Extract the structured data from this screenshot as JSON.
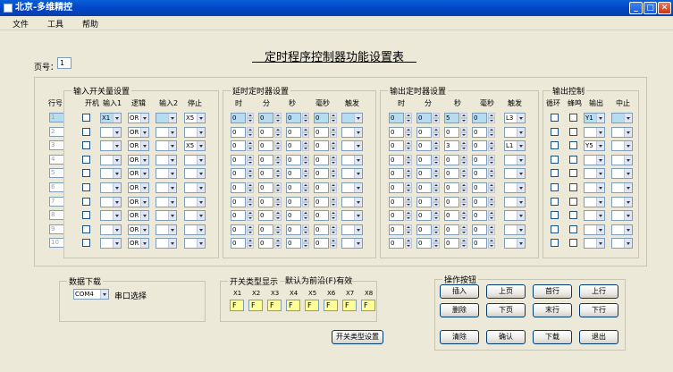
{
  "window": {
    "title": "北京-多维精控",
    "min": "_",
    "max": "□",
    "close": "✕"
  },
  "menu": [
    "文件",
    "工具",
    "帮助"
  ],
  "main_title": "定时程序控制器功能设置表",
  "page": {
    "label": "页号：",
    "value": "1"
  },
  "row_header": "行号",
  "row_numbers": [
    "1",
    "2",
    "3",
    "4",
    "5",
    "6",
    "7",
    "8",
    "9",
    "10"
  ],
  "input_switch": {
    "title": "输入开关量设置",
    "headers": [
      "开机",
      "输入1",
      "逻辑",
      "输入2",
      "停止"
    ],
    "rows": [
      {
        "in1": "X1",
        "logic": "OR",
        "in2": "",
        "stop": "X5"
      },
      {
        "in1": "",
        "logic": "OR",
        "in2": "",
        "stop": ""
      },
      {
        "in1": "",
        "logic": "OR",
        "in2": "",
        "stop": "X5"
      },
      {
        "in1": "",
        "logic": "OR",
        "in2": "",
        "stop": ""
      },
      {
        "in1": "",
        "logic": "OR",
        "in2": "",
        "stop": ""
      },
      {
        "in1": "",
        "logic": "OR",
        "in2": "",
        "stop": ""
      },
      {
        "in1": "",
        "logic": "OR",
        "in2": "",
        "stop": ""
      },
      {
        "in1": "",
        "logic": "OR",
        "in2": "",
        "stop": ""
      },
      {
        "in1": "",
        "logic": "OR",
        "in2": "",
        "stop": ""
      },
      {
        "in1": "",
        "logic": "OR",
        "in2": "",
        "stop": ""
      }
    ]
  },
  "delay_timer": {
    "title": "延时定时器设置",
    "headers": [
      "时",
      "分",
      "秒",
      "毫秒",
      "触发"
    ],
    "rows": [
      {
        "h": "0",
        "m": "0",
        "s": "0",
        "ms": "0",
        "trig": ""
      },
      {
        "h": "0",
        "m": "0",
        "s": "0",
        "ms": "0",
        "trig": ""
      },
      {
        "h": "0",
        "m": "0",
        "s": "0",
        "ms": "0",
        "trig": ""
      },
      {
        "h": "0",
        "m": "0",
        "s": "0",
        "ms": "0",
        "trig": ""
      },
      {
        "h": "0",
        "m": "0",
        "s": "0",
        "ms": "0",
        "trig": ""
      },
      {
        "h": "0",
        "m": "0",
        "s": "0",
        "ms": "0",
        "trig": ""
      },
      {
        "h": "0",
        "m": "0",
        "s": "0",
        "ms": "0",
        "trig": ""
      },
      {
        "h": "0",
        "m": "0",
        "s": "0",
        "ms": "0",
        "trig": ""
      },
      {
        "h": "0",
        "m": "0",
        "s": "0",
        "ms": "0",
        "trig": ""
      },
      {
        "h": "0",
        "m": "0",
        "s": "0",
        "ms": "0",
        "trig": ""
      }
    ]
  },
  "output_timer": {
    "title": "输出定时器设置",
    "headers": [
      "时",
      "分",
      "秒",
      "毫秒",
      "触发"
    ],
    "rows": [
      {
        "h": "0",
        "m": "0",
        "s": "5",
        "ms": "0",
        "trig": "L3"
      },
      {
        "h": "0",
        "m": "0",
        "s": "0",
        "ms": "0",
        "trig": ""
      },
      {
        "h": "0",
        "m": "0",
        "s": "3",
        "ms": "0",
        "trig": "L1"
      },
      {
        "h": "0",
        "m": "0",
        "s": "0",
        "ms": "0",
        "trig": ""
      },
      {
        "h": "0",
        "m": "0",
        "s": "0",
        "ms": "0",
        "trig": ""
      },
      {
        "h": "0",
        "m": "0",
        "s": "0",
        "ms": "0",
        "trig": ""
      },
      {
        "h": "0",
        "m": "0",
        "s": "0",
        "ms": "0",
        "trig": ""
      },
      {
        "h": "0",
        "m": "0",
        "s": "0",
        "ms": "0",
        "trig": ""
      },
      {
        "h": "0",
        "m": "0",
        "s": "0",
        "ms": "0",
        "trig": ""
      },
      {
        "h": "0",
        "m": "0",
        "s": "0",
        "ms": "0",
        "trig": ""
      }
    ]
  },
  "output_control": {
    "title": "输出控制",
    "headers": [
      "循环",
      "蜂鸣",
      "输出",
      "中止"
    ],
    "rows": [
      {
        "out": "Y1",
        "abort": ""
      },
      {
        "out": "",
        "abort": ""
      },
      {
        "out": "Y5",
        "abort": ""
      },
      {
        "out": "",
        "abort": ""
      },
      {
        "out": "",
        "abort": ""
      },
      {
        "out": "",
        "abort": ""
      },
      {
        "out": "",
        "abort": ""
      },
      {
        "out": "",
        "abort": ""
      },
      {
        "out": "",
        "abort": ""
      },
      {
        "out": "",
        "abort": ""
      }
    ]
  },
  "download": {
    "title": "数据下载",
    "port": "COM4",
    "port_label": "串口选择"
  },
  "switch_display": {
    "title": "开关类型显示",
    "note": "默认为前沿(F)有效",
    "labels": [
      "X1",
      "X2",
      "X3",
      "X4",
      "X5",
      "X6",
      "X7",
      "X8"
    ],
    "values": [
      "F",
      "F",
      "F",
      "F",
      "F",
      "F",
      "F",
      "F"
    ],
    "button": "开关类型设置"
  },
  "ops": {
    "title": "操作按钮",
    "row1": [
      "插入",
      "上页",
      "首行",
      "上行"
    ],
    "row2": [
      "删除",
      "下页",
      "末行",
      "下行"
    ],
    "row3": [
      "清除",
      "确认",
      "下载",
      "退出"
    ]
  },
  "colors": {
    "selected": "#b6dcf0",
    "switch_box": "#ffff99",
    "title_bar": "#0046c8"
  }
}
